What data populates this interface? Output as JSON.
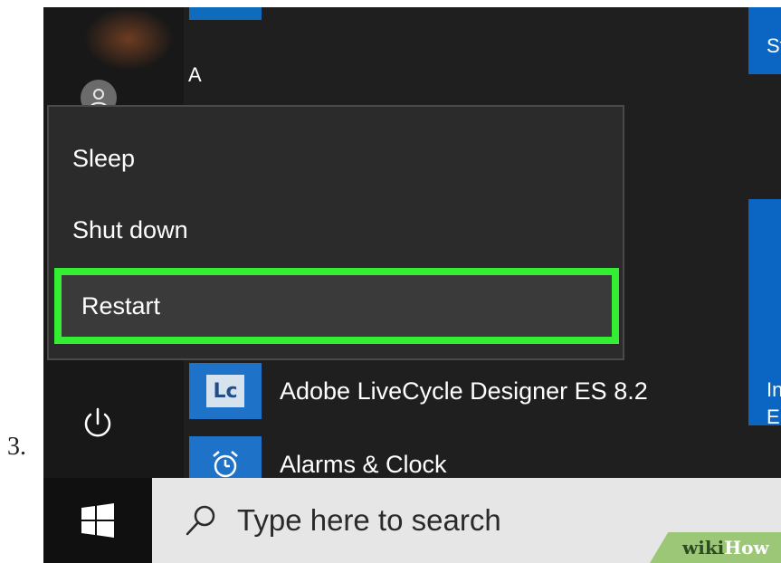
{
  "step_number": "3.",
  "start_menu": {
    "letter_header": "A",
    "apps": [
      {
        "label": "Adobe LiveCycle Designer ES 8.2",
        "tile_text": "Lc"
      },
      {
        "label": "Alarms & Clock"
      }
    ],
    "right_tiles": [
      {
        "text": "St"
      },
      {
        "text": "In\nE:"
      }
    ]
  },
  "power_menu": {
    "items": [
      {
        "label": "Sleep"
      },
      {
        "label": "Shut down"
      },
      {
        "label": "Restart",
        "highlighted": true
      }
    ],
    "highlight_color": "#33ee33"
  },
  "taskbar": {
    "search_placeholder": "Type here to search"
  },
  "watermark": {
    "wiki": "wiki",
    "how": "How"
  },
  "colors": {
    "accent": "#0a66c2",
    "menu_background": "#2b2b2b",
    "search_box": "#e6e6e6"
  },
  "icons": [
    "user-avatar-icon",
    "power-icon",
    "windows-logo-icon",
    "search-icon",
    "alarm-clock-icon"
  ]
}
